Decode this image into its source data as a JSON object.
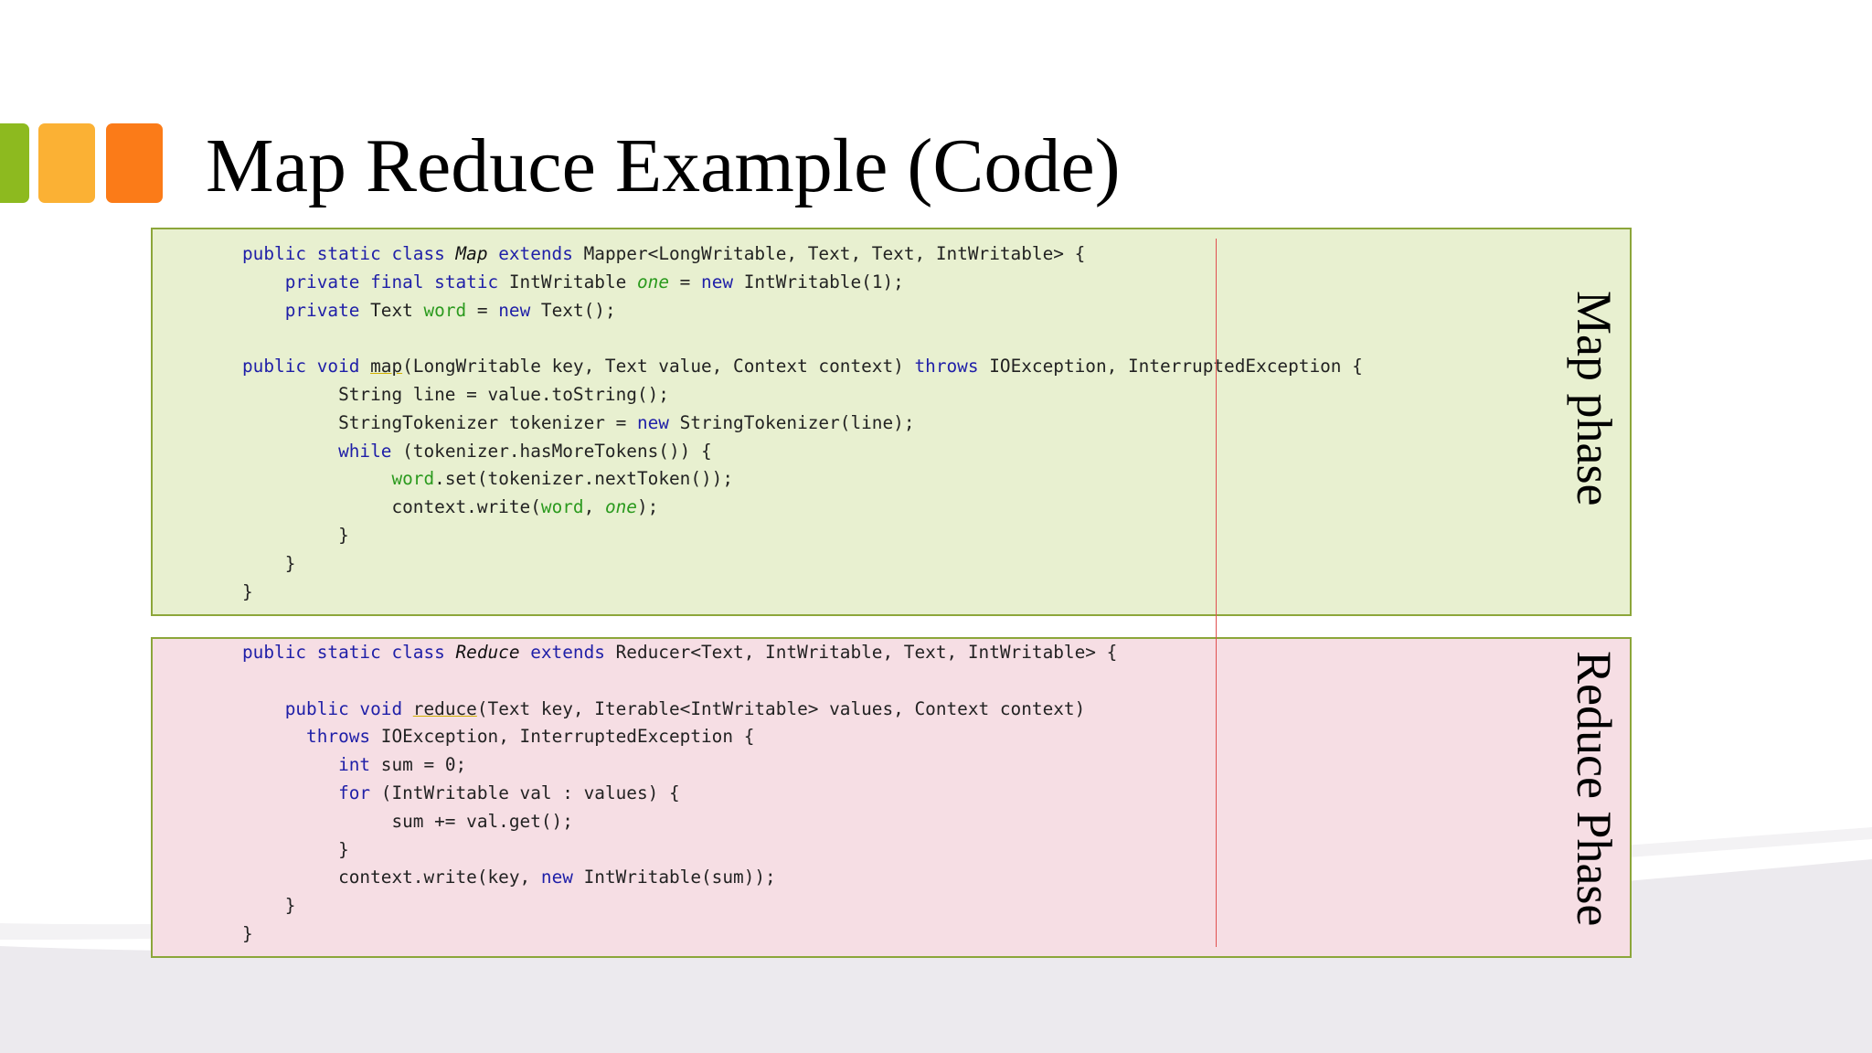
{
  "slide": {
    "title": "Map Reduce Example (Code)",
    "map_label": "Map phase",
    "reduce_label": "Reduce Phase"
  },
  "colors": {
    "square_green": "#8dba1f",
    "square_yellow": "#fbb134",
    "square_orange": "#fb7b18",
    "map_box_fill": "#e8f0d0",
    "reduce_box_fill": "#f6dee4",
    "box_border": "#8ca63a",
    "keyword": "#1f1fa8",
    "field": "#2b9a1e"
  },
  "map_code": [
    [
      [
        "kw",
        "public static class "
      ],
      [
        "cls",
        "Map"
      ],
      [
        "kw",
        " extends "
      ],
      [
        "",
        "Mapper<LongWritable, Text, Text, IntWritable> {"
      ]
    ],
    [
      [
        "",
        "    "
      ],
      [
        "kw",
        "private final static "
      ],
      [
        "",
        "IntWritable "
      ],
      [
        "fldi",
        "one"
      ],
      [
        "",
        " = "
      ],
      [
        "kw",
        "new "
      ],
      [
        "",
        "IntWritable(1);"
      ]
    ],
    [
      [
        "",
        "    "
      ],
      [
        "kw",
        "private "
      ],
      [
        "",
        "Text "
      ],
      [
        "fld",
        "word"
      ],
      [
        "",
        " = "
      ],
      [
        "kw",
        "new "
      ],
      [
        "",
        "Text();"
      ]
    ],
    [
      [
        "",
        ""
      ]
    ],
    [
      [
        "kw",
        "public void "
      ],
      [
        "mth",
        "map"
      ],
      [
        "",
        "(LongWritable key, Text value, Context context) "
      ],
      [
        "kw",
        "throws "
      ],
      [
        "",
        "IOException, InterruptedException {"
      ]
    ],
    [
      [
        "",
        "         String line = value.toString();"
      ]
    ],
    [
      [
        "",
        "         StringTokenizer tokenizer = "
      ],
      [
        "kw",
        "new "
      ],
      [
        "",
        "StringTokenizer(line);"
      ]
    ],
    [
      [
        "",
        "         "
      ],
      [
        "kw",
        "while "
      ],
      [
        "",
        "(tokenizer.hasMoreTokens()) {"
      ]
    ],
    [
      [
        "",
        "              "
      ],
      [
        "fld",
        "word"
      ],
      [
        "",
        ".set(tokenizer.nextToken());"
      ]
    ],
    [
      [
        "",
        "              context.write("
      ],
      [
        "fld",
        "word"
      ],
      [
        ",",
        ", "
      ],
      [
        "fldi",
        "one"
      ],
      [
        "",
        ");"
      ]
    ],
    [
      [
        "",
        "         }"
      ]
    ],
    [
      [
        "",
        "    }"
      ]
    ],
    [
      [
        "",
        "}"
      ]
    ]
  ],
  "reduce_code": [
    [
      [
        "kw",
        "public static class "
      ],
      [
        "cls",
        "Reduce"
      ],
      [
        "kw",
        " extends "
      ],
      [
        "",
        "Reducer<Text, IntWritable, Text, IntWritable> {"
      ]
    ],
    [
      [
        "",
        ""
      ]
    ],
    [
      [
        "",
        "    "
      ],
      [
        "kw",
        "public void "
      ],
      [
        "mth",
        "reduce"
      ],
      [
        "",
        "(Text key, Iterable<IntWritable> values, Context context)"
      ]
    ],
    [
      [
        "",
        "      "
      ],
      [
        "kw",
        "throws "
      ],
      [
        "",
        "IOException, InterruptedException {"
      ]
    ],
    [
      [
        "",
        "         "
      ],
      [
        "kw",
        "int "
      ],
      [
        "",
        "sum = 0;"
      ]
    ],
    [
      [
        "",
        "         "
      ],
      [
        "kw",
        "for "
      ],
      [
        "",
        "(IntWritable val : values) {"
      ]
    ],
    [
      [
        "",
        "              sum += val.get();"
      ]
    ],
    [
      [
        "",
        "         }"
      ]
    ],
    [
      [
        "",
        "         context.write(key, "
      ],
      [
        "kw",
        "new "
      ],
      [
        "",
        "IntWritable(sum));"
      ]
    ],
    [
      [
        "",
        "    }"
      ]
    ],
    [
      [
        "",
        "}"
      ]
    ]
  ]
}
